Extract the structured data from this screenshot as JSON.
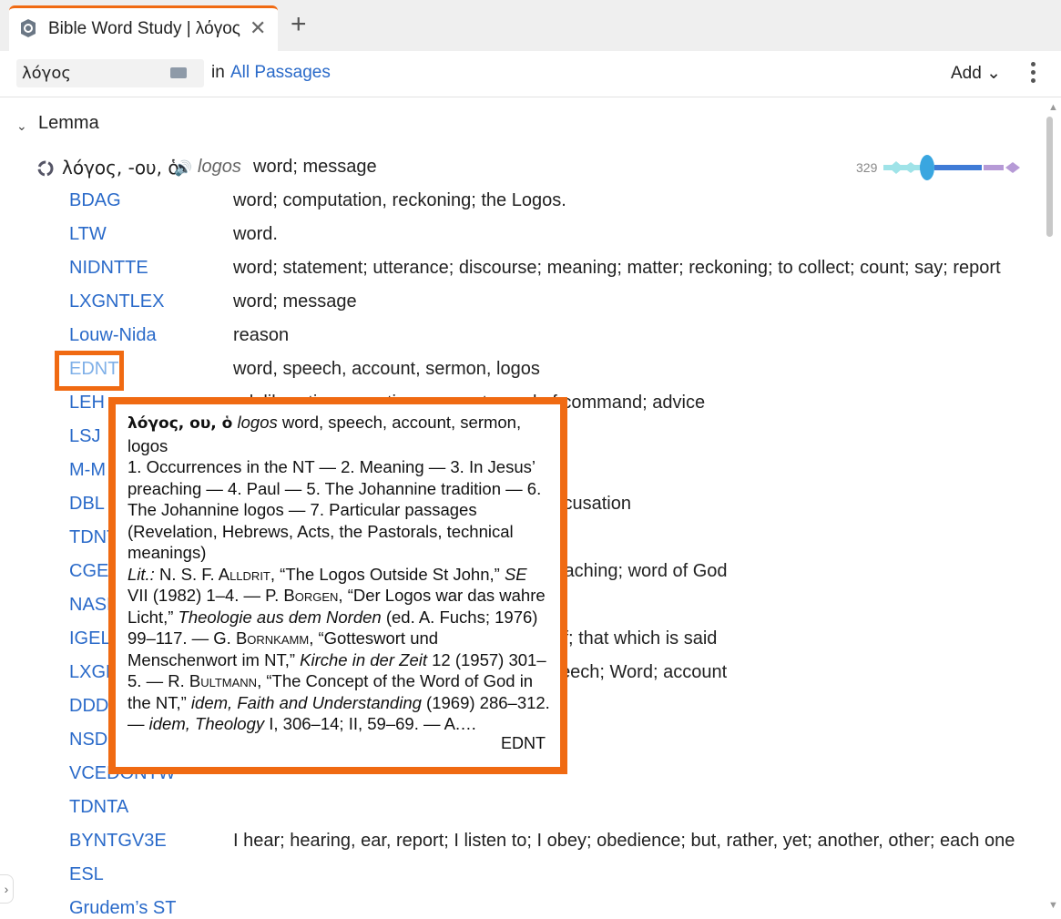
{
  "tab": {
    "title": "Bible Word Study | λόγος",
    "close": "✕",
    "new_tab": "+"
  },
  "toolbar": {
    "search_value": "λόγος",
    "in_label": "in",
    "passages_link": "All Passages",
    "add_label": "Add ⌄"
  },
  "section": {
    "toggle": "⌄",
    "title": "Lemma"
  },
  "lemma": {
    "head": "λόγος, -ου, ὁ",
    "speaker": "🔊",
    "translit": "logos",
    "gloss": "word; message",
    "count": "329"
  },
  "rows": [
    {
      "resource": "BDAG",
      "definition": "word; computation, reckoning; the Logos."
    },
    {
      "resource": "LTW",
      "definition": "word."
    },
    {
      "resource": "NIDNTTE",
      "definition": "word; statement; utterance; discourse; meaning; matter; reckoning; to collect; count; say; report"
    },
    {
      "resource": "LXGNTLEX",
      "definition": "word; message"
    },
    {
      "resource": "Louw-Nida",
      "definition": "reason"
    },
    {
      "resource": "EDNT",
      "definition": "word, speech, account, sermon, logos"
    },
    {
      "resource": "LEH",
      "definition": "; deliberation; question, request; word of command; advice"
    },
    {
      "resource": "LSJ",
      "definition": ""
    },
    {
      "resource": "M-M",
      "definition": ""
    },
    {
      "resource": "DBL",
      "definition": "; account; reason; event; appearance; accusation"
    },
    {
      "resource": "TDNT",
      "definition": ""
    },
    {
      "resource": "CGED",
      "definition": "eaching; talk, conversation; question; preaching; word of God"
    },
    {
      "resource": "NASE",
      "definition": ""
    },
    {
      "resource": "IGEL",
      "definition": "ght is expressed; the inward thought itself; that which is said"
    },
    {
      "resource": "LXGR",
      "definition": "ce; statement; saying; word of mouth; speech; Word; account"
    },
    {
      "resource": "DDD",
      "definition": ""
    },
    {
      "resource": "NSDI",
      "definition": "omputation; Expression; Christ"
    },
    {
      "resource": "VCEDONTW",
      "definition": ""
    },
    {
      "resource": "TDNTA",
      "definition": ""
    },
    {
      "resource": "BYNTGV3E",
      "definition": "I hear; hearing, ear, report; I listen to; I obey; obedience; but, rather, yet; another, other; each one"
    },
    {
      "resource": "ESL",
      "definition": ""
    },
    {
      "resource": "Grudem’s ST",
      "definition": ""
    }
  ],
  "popup": {
    "headword": "λόγος, ου, ὁ",
    "translit": "logos",
    "gloss": "word, speech, account, sermon, logos",
    "outline": "1. Occurrences in the NT — 2. Meaning — 3. In Jesus’ preaching — 4. Paul — 5. The Johannine tradition — 6. The Johannine logos — 7. Particular passages (Revelation, Hebrews, Acts, the Pastorals, technical meanings)",
    "lit_label": "Lit.:",
    "author1": "N. S. F. Alldrit",
    "ref1": ", “The Logos Outside St John,”",
    "journal1": "SE",
    "ref1b": "VII (1982) 1–4. — P.",
    "author2": "Borgen",
    "ref2": ", “Der Logos war das wahre Licht,”",
    "book2": "Theologie aus dem Norden",
    "ref2b": "(ed. A. Fuchs; 1976) 99–117. — G.",
    "author3": "Bornkamm",
    "ref3": ", “Gotteswort und Menschenwort im NT,”",
    "book3": "Kirche in der Zeit",
    "ref3b": "12 (1957) 301–5. — R.",
    "author4": "Bultmann",
    "ref4": ", “The Concept of the Word of God in the NT,”",
    "book4": "idem, Faith and Understanding",
    "ref4b": "(1969) 286–312. —",
    "book5": "idem, Theology",
    "ref5": "I, 306–14; II, 59–69. — A.…",
    "source": "EDNT"
  },
  "colors": {
    "accent": "#f06a12",
    "link": "#2a6ac9"
  }
}
